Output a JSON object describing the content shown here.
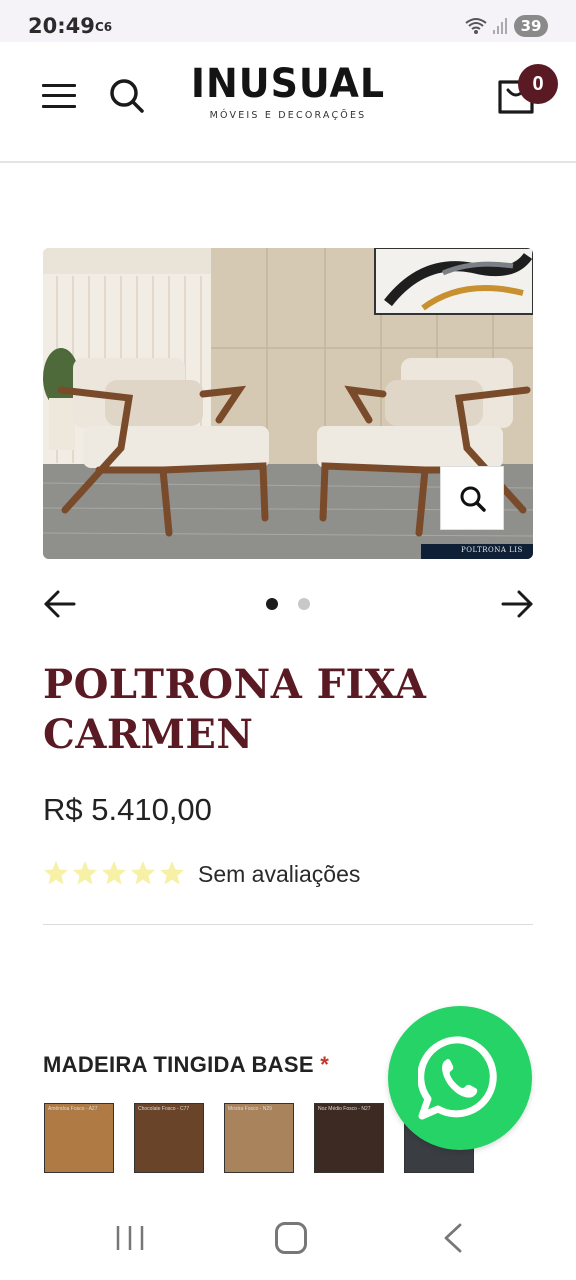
{
  "status_bar": {
    "time": "20:49",
    "carrier_icon": "C6",
    "battery": "39"
  },
  "header": {
    "logo_title": "INUSUAL",
    "logo_subtitle": "MÓVEIS E DECORAÇÕES",
    "cart_count": "0"
  },
  "gallery": {
    "image_caption": "POLTRONA LIS",
    "active_slide": 1,
    "slide_count": 2
  },
  "product": {
    "title": "POLTRONA FIXA CARMEN",
    "price": "R$ 5.410,00",
    "rating_stars": 0,
    "rating_max": 5,
    "reviews_text": "Sem avaliações"
  },
  "options": {
    "label": "MADEIRA TINGIDA BASE",
    "required_mark": "*",
    "swatches": [
      {
        "name": "Amêndoa Fosco - A27",
        "color": "#b07a45"
      },
      {
        "name": "Chocolate Fosco - C77",
        "color": "#6a4428"
      },
      {
        "name": "Mostra Fosco - N29",
        "color": "#a9835c"
      },
      {
        "name": "Noz Médio Fosco - N27",
        "color": "#3d2a22"
      },
      {
        "name": "",
        "color": "#3a3d42"
      }
    ]
  },
  "colors": {
    "brand": "#5a1a23",
    "whatsapp": "#25d366",
    "star": "#f7f1a8"
  },
  "icons": {
    "menu": "hamburger-icon",
    "search": "search-icon",
    "cart": "shopping-bag-icon",
    "zoom": "zoom-icon",
    "prev": "arrow-left-icon",
    "next": "arrow-right-icon",
    "whatsapp": "whatsapp-icon"
  }
}
